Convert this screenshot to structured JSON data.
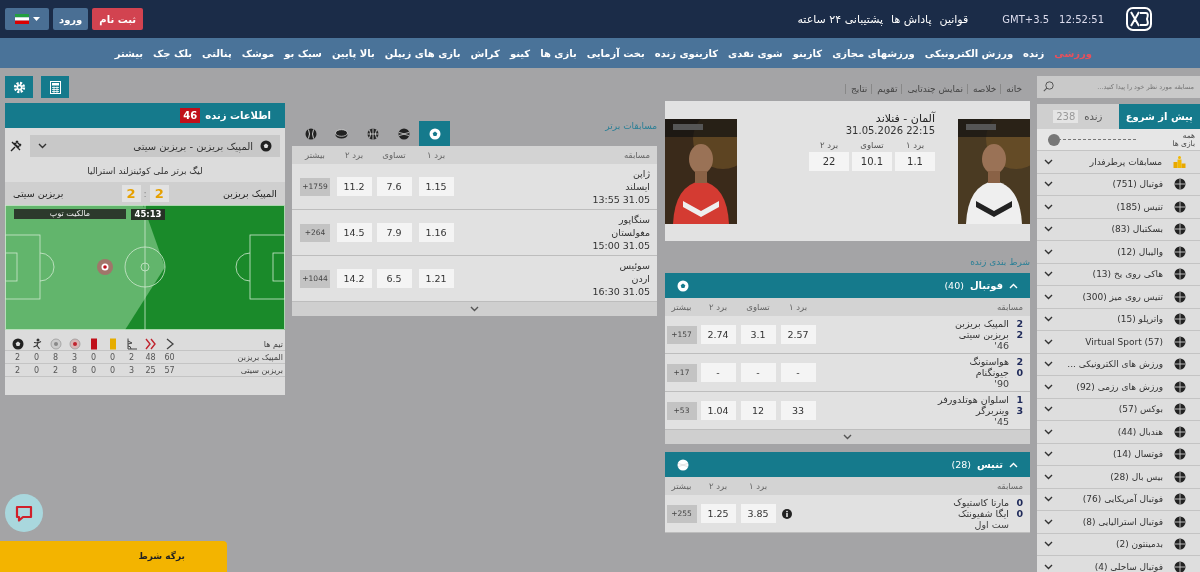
{
  "header": {
    "clock": "12:52:51",
    "timezone": "GMT+3.5",
    "links": [
      "قوانین",
      "پاداش ها",
      "پشتیبانی ۲۴ ساعته"
    ],
    "register": "ثبت نام",
    "login": "ورود"
  },
  "nav": [
    {
      "label": "ورزشی",
      "selected": true
    },
    {
      "label": "زنده",
      "selected": false
    },
    {
      "label": "ورزش الکترونیکی",
      "selected": false
    },
    {
      "label": "ورزشهای مجازی",
      "selected": false
    },
    {
      "label": "کازینو",
      "selected": false
    },
    {
      "label": "شوی نقدی",
      "selected": false
    },
    {
      "label": "کازینوی زنده",
      "selected": false
    },
    {
      "label": "بخت آزمایی",
      "selected": false
    },
    {
      "label": "بازی ها",
      "selected": false
    },
    {
      "label": "کینو",
      "selected": false
    },
    {
      "label": "کراش",
      "selected": false
    },
    {
      "label": "بازی های زیپلن",
      "selected": false
    },
    {
      "label": "بالا پایین",
      "selected": false
    },
    {
      "label": "سیک بو",
      "selected": false
    },
    {
      "label": "موشک",
      "selected": false
    },
    {
      "label": "پنالتی",
      "selected": false
    },
    {
      "label": "بلک جک",
      "selected": false
    },
    {
      "label": "بیشتر",
      "selected": false
    }
  ],
  "live_info": {
    "title": "اطلاعات زنده",
    "count": "46",
    "match": "المپیک بریزبن - بریزبن سیتی",
    "league": "لیگ برتر ملی کوئینزلند استرالیا",
    "home": "المپیک بریزبن",
    "away": "بریزبن سیتی",
    "home_score": "2",
    "score_separator": ":",
    "away_score": "2",
    "possession_label": "مالکیت توپ",
    "clock": "45:13",
    "stats_header": "تیم ها",
    "stats": [
      {
        "team": "المپیک بریزبن",
        "values": [
          "60",
          "48",
          "2",
          "0",
          "0",
          "3",
          "8",
          "0",
          "2"
        ]
      },
      {
        "team": "بریزبن سیتی",
        "values": [
          "57",
          "25",
          "3",
          "0",
          "0",
          "8",
          "2",
          "0",
          "2"
        ]
      }
    ]
  },
  "top_matches": {
    "title": "مسابقات برتر",
    "tabs": [
      {
        "kind": "football",
        "selected": true
      },
      {
        "kind": "tennis",
        "selected": false
      },
      {
        "kind": "basketball",
        "selected": false
      },
      {
        "kind": "hockey",
        "selected": false
      },
      {
        "kind": "baseball",
        "selected": false
      }
    ],
    "columns": [
      "مسابقه",
      "برد ۱",
      "تساوی",
      "برد ۲",
      "بیشتر"
    ],
    "rows": [
      {
        "home": "ژاپن",
        "away": "ایسلند",
        "time": "13:55 31.05",
        "odds": [
          "1.15",
          "7.6",
          "11.2"
        ],
        "more": "+1759"
      },
      {
        "home": "سنگاپور",
        "away": "مغولستان",
        "time": "15:00 31.05",
        "odds": [
          "1.16",
          "7.9",
          "14.5"
        ],
        "more": "+264"
      },
      {
        "home": "سوئیس",
        "away": "اردن",
        "time": "16:30 31.05",
        "odds": [
          "1.21",
          "6.5",
          "14.2"
        ],
        "more": "+1044"
      }
    ]
  },
  "breadcrumbs": [
    "خانه",
    "خلاصه",
    "نمایش چندتایی",
    "تقویم",
    "نتایج"
  ],
  "featured": {
    "title": "آلمان - فنلاند",
    "date": "31.05.2026 22:15",
    "labels": [
      "برد ۱",
      "تساوی",
      "برد ۲"
    ],
    "odds": [
      "1.1",
      "10.1",
      "22"
    ]
  },
  "live_title": "شرط بندی زنده",
  "groups": [
    {
      "kind": "football",
      "name": "فوتبال",
      "count": "(40)",
      "expanded": true,
      "columns": [
        "مسابقه",
        "برد ۱",
        "تساوی",
        "برد ۲",
        "بیشتر"
      ],
      "rows": [
        {
          "teams": [
            {
              "name": "المپیک بریزبن",
              "score": "2"
            },
            {
              "name": "بریزبن سیتی",
              "score": "2"
            }
          ],
          "status": "'46",
          "odds": [
            "2.57",
            "3.1",
            "2.74"
          ],
          "more": "+157"
        },
        {
          "teams": [
            {
              "name": "هواستونگ",
              "score": "2"
            },
            {
              "name": "جیونگنام",
              "score": "0"
            }
          ],
          "status": "'90",
          "odds": [
            "-",
            "-",
            "-"
          ],
          "more": "+17"
        },
        {
          "teams": [
            {
              "name": "اسلوان هوتلدورفر",
              "score": "1"
            },
            {
              "name": "وینربرگر",
              "score": "3"
            }
          ],
          "status": "'45",
          "odds": [
            "33",
            "12",
            "1.04"
          ],
          "more": "+53"
        }
      ]
    },
    {
      "kind": "tennis",
      "name": "تنیس",
      "count": "(28)",
      "expanded": true,
      "columns": [
        "مسابقه",
        "برد ۱",
        "برد ۲",
        "بیشتر"
      ],
      "rows": [
        {
          "teams": [
            {
              "name": "مارتا کاستیوک",
              "score": "0"
            },
            {
              "name": "ایگا شفیونتک",
              "score": "0"
            }
          ],
          "status": "ست اول",
          "odds": [
            "3.85",
            "1.25"
          ],
          "more": "+255",
          "info": true
        }
      ]
    }
  ],
  "sidebar": {
    "search_placeholder": "مسابقه مورد نظر خود را پیدا کنید...",
    "tabs": [
      {
        "label": "پیش از شروع",
        "selected": true
      },
      {
        "label": "زنده",
        "count": "238",
        "selected": false
      }
    ],
    "all_games": {
      "label_top": "همه",
      "label_bottom": "بازی ها",
      "on": false
    },
    "sports": [
      {
        "kind": "featured",
        "label": "مسابقات پرطرفدار"
      },
      {
        "kind": "sport",
        "label": "فوتبال (751)"
      },
      {
        "kind": "sport",
        "label": "تنیس (185)"
      },
      {
        "kind": "sport",
        "label": "بسکتبال (83)"
      },
      {
        "kind": "sport",
        "label": "والیبال (12)"
      },
      {
        "kind": "sport",
        "label": "هاکی روی یخ (13)"
      },
      {
        "kind": "sport",
        "label": "تنیس روی میز (300)"
      },
      {
        "kind": "sport",
        "label": "واترپلو (15)"
      },
      {
        "kind": "sport",
        "label": "Virtual Sport (57)"
      },
      {
        "kind": "sport",
        "label": "ورزش های الکترونیکی ..."
      },
      {
        "kind": "sport",
        "label": "ورزش های رزمی (92)"
      },
      {
        "kind": "sport",
        "label": "بوکس (57)"
      },
      {
        "kind": "sport",
        "label": "هندبال (44)"
      },
      {
        "kind": "sport",
        "label": "فوتسال (14)"
      },
      {
        "kind": "sport",
        "label": "بیس بال (28)"
      },
      {
        "kind": "sport",
        "label": "فوتبال آمریکایی (76)"
      },
      {
        "kind": "sport",
        "label": "فوتبال استرالیایی (8)"
      },
      {
        "kind": "sport",
        "label": "بدمینتون (2)"
      },
      {
        "kind": "sport",
        "label": "فوتبال ساحلی (4)"
      }
    ]
  },
  "bet_slip": "برگه شرط"
}
